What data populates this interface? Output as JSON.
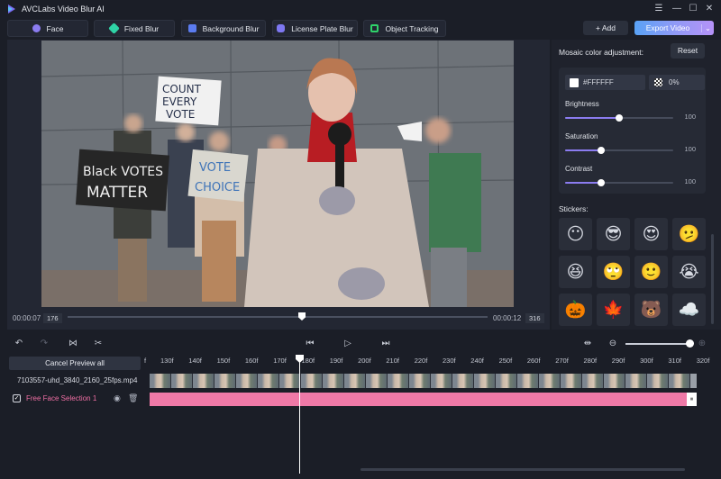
{
  "app": {
    "title": "AVCLabs Video Blur AI"
  },
  "window_controls": [
    "menu-icon",
    "minimize-icon",
    "maximize-icon",
    "close-icon"
  ],
  "mode_tabs": [
    {
      "label": "Face",
      "icon": "face-icon",
      "color": "#8b7cf0"
    },
    {
      "label": "Fixed Blur",
      "icon": "fixed-blur-icon",
      "color": "#2fd3a6"
    },
    {
      "label": "Background Blur",
      "icon": "background-blur-icon",
      "color": "#5b7cf0"
    },
    {
      "label": "License Plate Blur",
      "icon": "car-icon",
      "color": "#7e78f2"
    },
    {
      "label": "Object Tracking",
      "icon": "tracking-icon",
      "color": "#2fd36a"
    }
  ],
  "header_actions": {
    "add_label": "+ Add",
    "export_label": "Export Video"
  },
  "preview": {
    "current_time": "00:00:07",
    "current_frame": "176",
    "end_time": "00:00:12",
    "end_frame": "316",
    "sign_texts": [
      "COUNT EVERY VOTE",
      "Black VOTES MATTER",
      "VOTE CHOICE"
    ]
  },
  "mosaic": {
    "title": "Mosaic color adjustment:",
    "reset_label": "Reset",
    "color_value": "#FFFFFF",
    "opacity_value": "0%",
    "sliders": [
      {
        "label": "Brightness",
        "value": "100",
        "fraction": 0.5
      },
      {
        "label": "Saturation",
        "value": "100",
        "fraction": 0.33
      },
      {
        "label": "Contrast",
        "value": "100",
        "fraction": 0.33
      }
    ]
  },
  "stickers": {
    "title": "Stickers:",
    "items": [
      "😶",
      "😎",
      "😍",
      "🫤",
      "😆",
      "🙄",
      "🙂",
      "😭",
      "🎃",
      "🍁",
      "🐻",
      "☁️"
    ]
  },
  "timeline": {
    "cancel_preview_label": "Cancel Preview all",
    "file_name": "7103557-uhd_3840_2160_25fps.mp4",
    "selection_name": "Free Face Selection 1",
    "ruler_ticks": [
      "f",
      "130f",
      "140f",
      "150f",
      "160f",
      "170f",
      "180f",
      "190f",
      "200f",
      "210f",
      "220f",
      "230f",
      "240f",
      "250f",
      "260f",
      "270f",
      "280f",
      "290f",
      "300f",
      "310f",
      "320f"
    ],
    "zoom_fraction": 0.95
  }
}
